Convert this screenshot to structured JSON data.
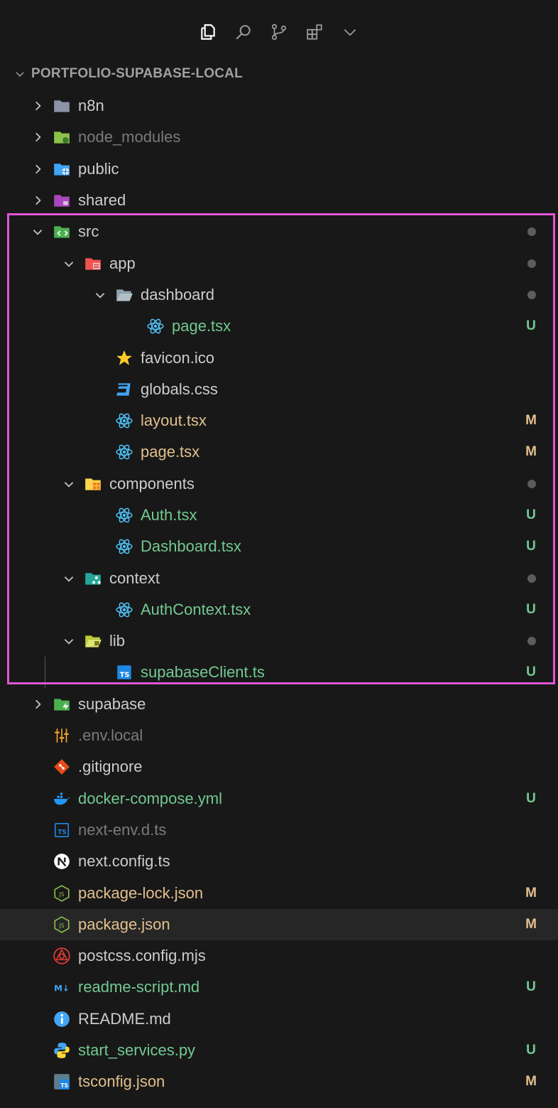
{
  "activity_bar": {
    "items": [
      {
        "name": "explorer-icon",
        "active": true
      },
      {
        "name": "search-icon",
        "active": false
      },
      {
        "name": "source-control-icon",
        "active": false
      },
      {
        "name": "extensions-icon",
        "active": false
      },
      {
        "name": "chevron-down-icon",
        "active": false
      }
    ]
  },
  "explorer": {
    "section_title": "PORTFOLIO-SUPABASE-LOCAL",
    "rows": [
      {
        "label": "n8n",
        "type": "folder",
        "expanded": false,
        "depth": 0,
        "icon": "folder-gray-icon",
        "status": "",
        "color": "normal"
      },
      {
        "label": "node_modules",
        "type": "folder",
        "expanded": false,
        "depth": 0,
        "icon": "folder-node-icon",
        "status": "",
        "color": "dim"
      },
      {
        "label": "public",
        "type": "folder",
        "expanded": false,
        "depth": 0,
        "icon": "folder-public-icon",
        "status": "",
        "color": "normal"
      },
      {
        "label": "shared",
        "type": "folder",
        "expanded": false,
        "depth": 0,
        "icon": "folder-shared-icon",
        "status": "",
        "color": "normal"
      },
      {
        "label": "src",
        "type": "folder",
        "expanded": true,
        "depth": 0,
        "icon": "folder-src-icon",
        "status": "dot",
        "color": "normal"
      },
      {
        "label": "app",
        "type": "folder",
        "expanded": true,
        "depth": 1,
        "icon": "folder-app-icon",
        "status": "dot",
        "color": "normal"
      },
      {
        "label": "dashboard",
        "type": "folder",
        "expanded": true,
        "depth": 2,
        "icon": "folder-open-icon",
        "status": "dot",
        "color": "normal"
      },
      {
        "label": "page.tsx",
        "type": "file",
        "depth": 3,
        "icon": "react-icon",
        "status": "U",
        "color": "untracked"
      },
      {
        "label": "favicon.ico",
        "type": "file",
        "depth": 2,
        "icon": "star-icon",
        "status": "",
        "color": "normal"
      },
      {
        "label": "globals.css",
        "type": "file",
        "depth": 2,
        "icon": "css-icon",
        "status": "",
        "color": "normal"
      },
      {
        "label": "layout.tsx",
        "type": "file",
        "depth": 2,
        "icon": "react-icon",
        "status": "M",
        "color": "modified"
      },
      {
        "label": "page.tsx",
        "type": "file",
        "depth": 2,
        "icon": "react-icon",
        "status": "M",
        "color": "modified"
      },
      {
        "label": "components",
        "type": "folder",
        "expanded": true,
        "depth": 1,
        "icon": "folder-components-icon",
        "status": "dot",
        "color": "normal"
      },
      {
        "label": "Auth.tsx",
        "type": "file",
        "depth": 2,
        "icon": "react-icon",
        "status": "U",
        "color": "untracked"
      },
      {
        "label": "Dashboard.tsx",
        "type": "file",
        "depth": 2,
        "icon": "react-icon",
        "status": "U",
        "color": "untracked"
      },
      {
        "label": "context",
        "type": "folder",
        "expanded": true,
        "depth": 1,
        "icon": "folder-context-icon",
        "status": "dot",
        "color": "normal"
      },
      {
        "label": "AuthContext.tsx",
        "type": "file",
        "depth": 2,
        "icon": "react-icon",
        "status": "U",
        "color": "untracked"
      },
      {
        "label": "lib",
        "type": "folder",
        "expanded": true,
        "depth": 1,
        "icon": "folder-lib-icon",
        "status": "dot",
        "color": "normal"
      },
      {
        "label": "supabaseClient.ts",
        "type": "file",
        "depth": 2,
        "icon": "ts-icon",
        "status": "U",
        "color": "untracked"
      },
      {
        "label": "supabase",
        "type": "folder",
        "expanded": false,
        "depth": 0,
        "icon": "folder-supabase-icon",
        "status": "",
        "color": "normal"
      },
      {
        "label": ".env.local",
        "type": "file",
        "depth": 0,
        "icon": "env-icon",
        "status": "",
        "color": "dim"
      },
      {
        "label": ".gitignore",
        "type": "file",
        "depth": 0,
        "icon": "git-icon",
        "status": "",
        "color": "normal"
      },
      {
        "label": "docker-compose.yml",
        "type": "file",
        "depth": 0,
        "icon": "docker-icon",
        "status": "U",
        "color": "untracked"
      },
      {
        "label": "next-env.d.ts",
        "type": "file",
        "depth": 0,
        "icon": "ts-outline-icon",
        "status": "",
        "color": "dim"
      },
      {
        "label": "next.config.ts",
        "type": "file",
        "depth": 0,
        "icon": "next-icon",
        "status": "",
        "color": "normal"
      },
      {
        "label": "package-lock.json",
        "type": "file",
        "depth": 0,
        "icon": "node-json-icon",
        "status": "M",
        "color": "modified"
      },
      {
        "label": "package.json",
        "type": "file",
        "depth": 0,
        "icon": "node-json-icon",
        "status": "M",
        "color": "modified",
        "hovered": true
      },
      {
        "label": "postcss.config.mjs",
        "type": "file",
        "depth": 0,
        "icon": "postcss-icon",
        "status": "",
        "color": "normal"
      },
      {
        "label": "readme-script.md",
        "type": "file",
        "depth": 0,
        "icon": "markdown-icon",
        "status": "U",
        "color": "untracked"
      },
      {
        "label": "README.md",
        "type": "file",
        "depth": 0,
        "icon": "info-icon",
        "status": "",
        "color": "normal"
      },
      {
        "label": "start_services.py",
        "type": "file",
        "depth": 0,
        "icon": "python-icon",
        "status": "U",
        "color": "untracked"
      },
      {
        "label": "tsconfig.json",
        "type": "file",
        "depth": 0,
        "icon": "tsconfig-icon",
        "status": "M",
        "color": "modified"
      }
    ]
  },
  "colors": {
    "background": "#181818",
    "modified": "#e2c08d",
    "untracked": "#73c991",
    "selection_border": "#e255d6",
    "dim_text": "#7a7a7a"
  }
}
